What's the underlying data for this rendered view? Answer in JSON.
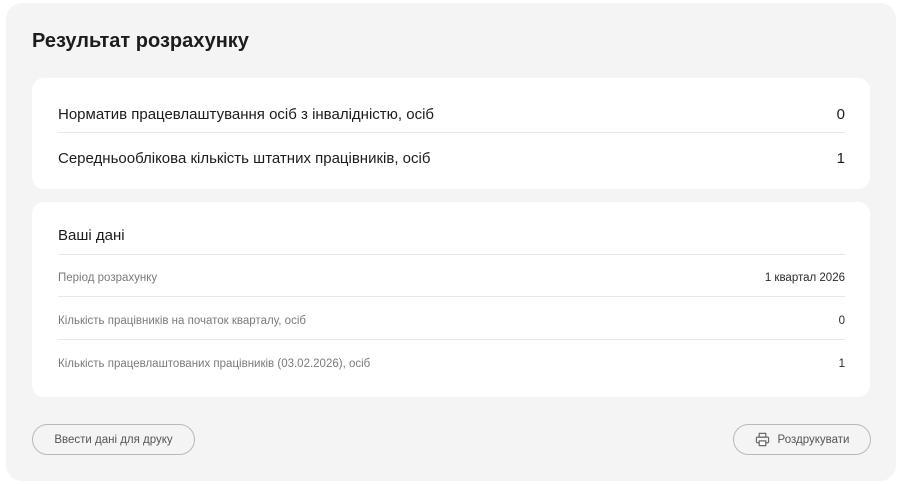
{
  "title": "Результат розрахунку",
  "results": {
    "rows": [
      {
        "label": "Норматив працевлаштування осіб з інвалідністю, осіб",
        "value": "0"
      },
      {
        "label": "Середньооблікова кількість штатних працівників, осіб",
        "value": "1"
      }
    ]
  },
  "your_data": {
    "title": "Ваші дані",
    "rows": [
      {
        "label": "Період розрахунку",
        "value": "1 квартал 2026"
      },
      {
        "label": "Кількість працівників на початок кварталу, осіб",
        "value": "0"
      },
      {
        "label": "Кількість працевлаштованих працівників (03.02.2026), осіб",
        "value": "1"
      }
    ]
  },
  "buttons": {
    "enter_data_label": "Ввести дані для друку",
    "print_label": "Роздрукувати",
    "print_icon": "printer-icon"
  },
  "colors": {
    "background": "#f4f4f4",
    "card": "#ffffff",
    "text": "#1c1c1c",
    "muted_text": "#7a7a7a",
    "border": "#b9b9b9"
  }
}
